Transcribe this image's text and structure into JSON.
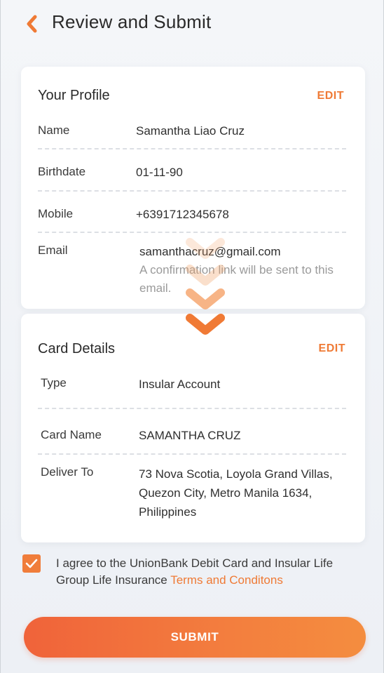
{
  "header": {
    "title": "Review and Submit"
  },
  "profile": {
    "title": "Your Profile",
    "edit_label": "EDIT",
    "rows": [
      {
        "label": "Name",
        "value": "Samantha Liao Cruz"
      },
      {
        "label": "Birthdate",
        "value": "01-11-90"
      },
      {
        "label": "Mobile",
        "value": "+6391712345678"
      },
      {
        "label": "Email",
        "value": "samanthacruz@gmail.com",
        "note": "A confirmation link will be sent to this email."
      }
    ]
  },
  "card_details": {
    "title": "Card Details",
    "edit_label": "EDIT",
    "rows": [
      {
        "label": "Type",
        "value": "Insular Account"
      },
      {
        "label": "Card Name",
        "value": "SAMANTHA CRUZ"
      },
      {
        "label": "Deliver To",
        "value_lines": [
          "73 Nova Scotia, Loyola Grand Villas,",
          "Quezon City, Metro Manila 1634,",
          "Philippines"
        ]
      }
    ]
  },
  "agreement": {
    "checked": true,
    "text": "I agree to the UnionBank Debit Card and Insular Life Group Life Insurance",
    "link_label": "Terms and Conditons"
  },
  "submit": {
    "label": "SUBMIT"
  },
  "colors": {
    "accent": "#ef7a35",
    "button_start": "#f0633a",
    "button_end": "#f48d3f"
  },
  "icons": {
    "back": "chevron-left-icon",
    "scroll_hint": "chevron-down-icon",
    "check": "checkmark-icon"
  }
}
